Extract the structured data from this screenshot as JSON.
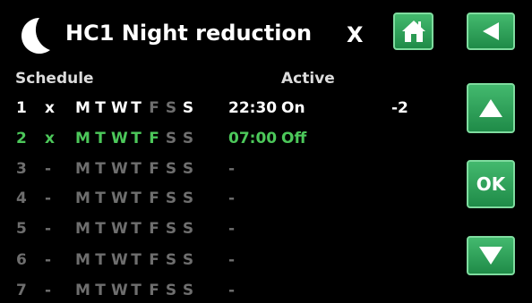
{
  "header": {
    "title": "HC1 Night reduction",
    "close_label": "X",
    "ok_label": "OK"
  },
  "icons": {
    "mode": "moon-icon",
    "home": "home-icon",
    "back": "back-arrow-icon",
    "up": "arrow-up-icon",
    "down": "arrow-down-icon"
  },
  "table": {
    "col_schedule": "Schedule",
    "col_active": "Active",
    "rows": [
      {
        "num": "1",
        "mark": "x",
        "days": [
          "M",
          "T",
          "W",
          "T",
          "F",
          "S",
          "S"
        ],
        "time": "22:30",
        "state": "On",
        "offset": "-2"
      },
      {
        "num": "2",
        "mark": "x",
        "days": [
          "M",
          "T",
          "W",
          "T",
          "F",
          "S",
          "S"
        ],
        "time": "07:00",
        "state": "Off",
        "offset": ""
      },
      {
        "num": "3",
        "mark": "-",
        "days": [
          "M",
          "T",
          "W",
          "T",
          "F",
          "S",
          "S"
        ],
        "time": "-",
        "state": "",
        "offset": ""
      },
      {
        "num": "4",
        "mark": "-",
        "days": [
          "M",
          "T",
          "W",
          "T",
          "F",
          "S",
          "S"
        ],
        "time": "-",
        "state": "",
        "offset": ""
      },
      {
        "num": "5",
        "mark": "-",
        "days": [
          "M",
          "T",
          "W",
          "T",
          "F",
          "S",
          "S"
        ],
        "time": "-",
        "state": "",
        "offset": ""
      },
      {
        "num": "6",
        "mark": "-",
        "days": [
          "M",
          "T",
          "W",
          "T",
          "F",
          "S",
          "S"
        ],
        "time": "-",
        "state": "",
        "offset": ""
      },
      {
        "num": "7",
        "mark": "-",
        "days": [
          "M",
          "T",
          "W",
          "T",
          "F",
          "S",
          "S"
        ],
        "time": "-",
        "state": "",
        "offset": ""
      }
    ]
  },
  "colors": {
    "background": "#000000",
    "text_white": "#ffffff",
    "text_green": "#4cc85a",
    "text_grey": "#6e6e6e",
    "button_green": "#2fa35a"
  }
}
